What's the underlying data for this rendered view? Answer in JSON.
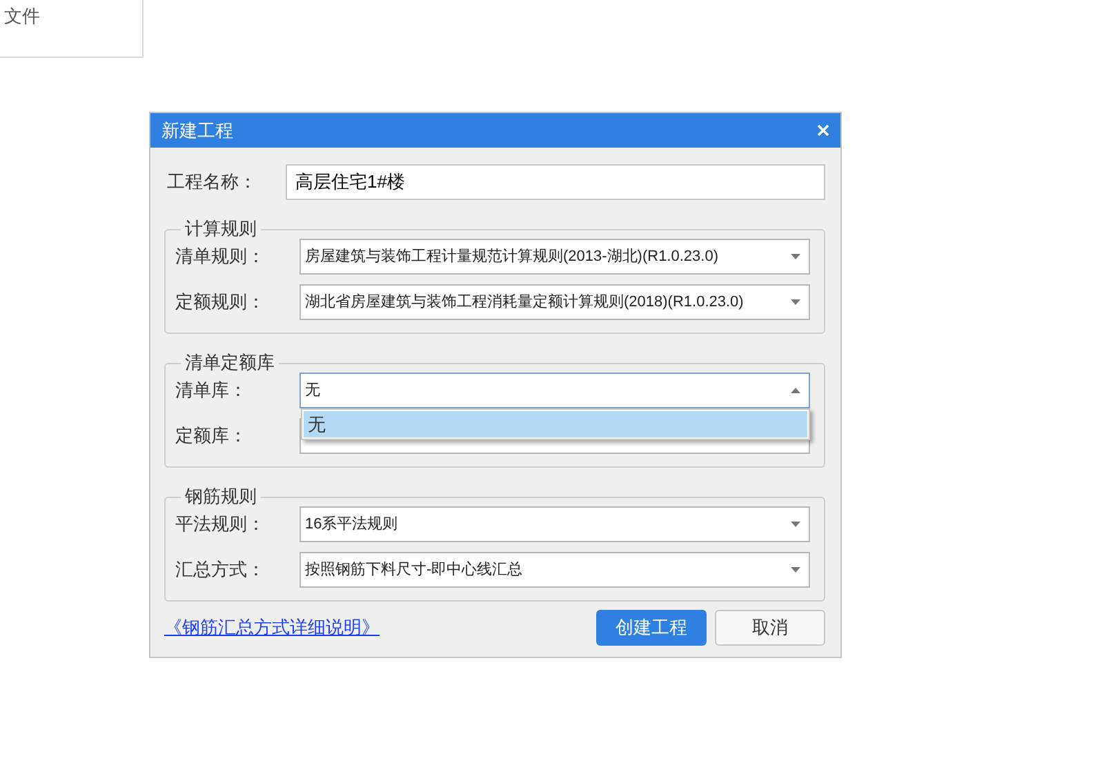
{
  "background_panel": {
    "text": "文件"
  },
  "dialog": {
    "title": "新建工程",
    "project_name": {
      "label": "工程名称：",
      "value": "高层住宅1#楼"
    },
    "groups": [
      {
        "title": "计算规则",
        "fields": [
          {
            "label": "清单规则：",
            "value": "房屋建筑与装饰工程计量规范计算规则(2013-湖北)(R1.0.23.0)",
            "expanded": false
          },
          {
            "label": "定额规则：",
            "value": "湖北省房屋建筑与装饰工程消耗量定额计算规则(2018)(R1.0.23.0)",
            "expanded": false
          }
        ]
      },
      {
        "title": "清单定额库",
        "fields": [
          {
            "label": "清单库：",
            "value": "无",
            "expanded": true,
            "options": [
              {
                "label": "无",
                "selected": true
              }
            ]
          },
          {
            "label": "定额库：",
            "expanded": false
          }
        ]
      },
      {
        "title": "钢筋规则",
        "fields": [
          {
            "label": "平法规则：",
            "value": "16系平法规则",
            "expanded": false
          },
          {
            "label": "汇总方式：",
            "value": "按照钢筋下料尺寸-即中心线汇总",
            "expanded": false
          }
        ]
      }
    ],
    "link": "《钢筋汇总方式详细说明》",
    "buttons": [
      {
        "label": "创建工程",
        "kind": "primary"
      },
      {
        "label": "取消",
        "kind": "secondary"
      }
    ]
  }
}
